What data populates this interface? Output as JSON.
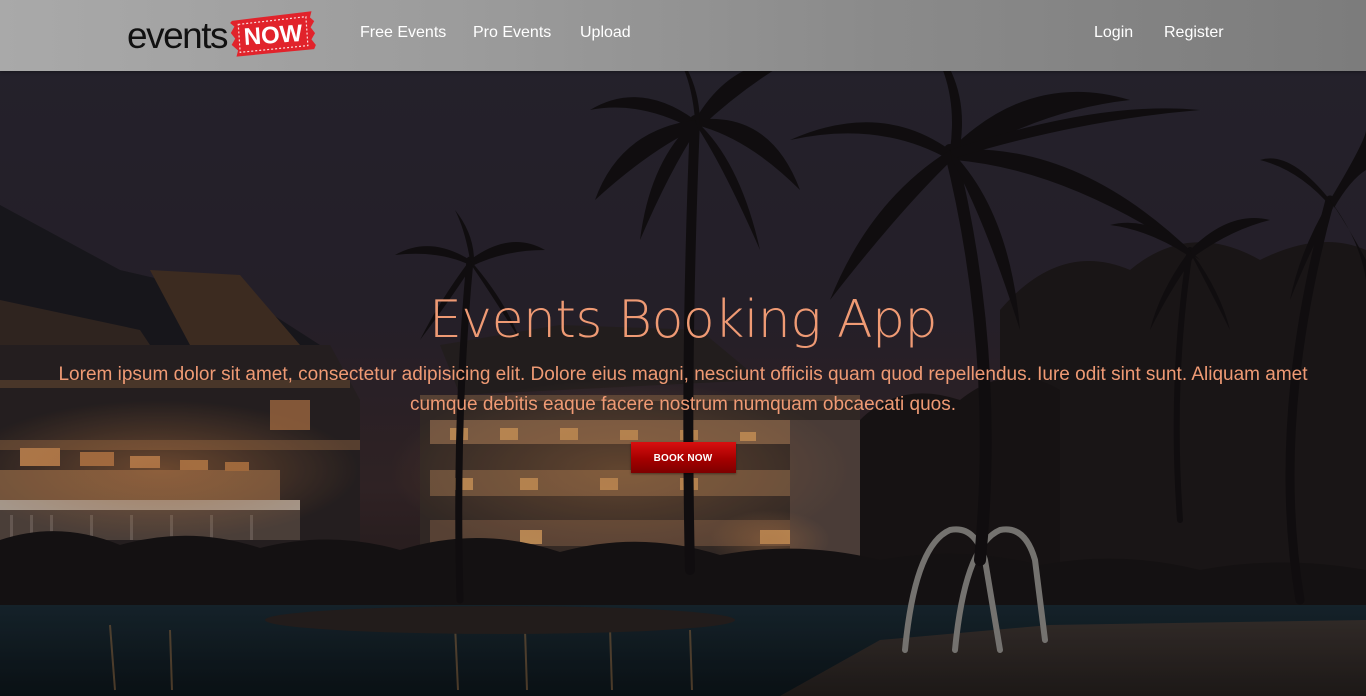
{
  "brand": {
    "logo_text_main": "events",
    "logo_text_badge": "NOW",
    "badge_color": "#e1232b"
  },
  "nav": {
    "left_links": [
      {
        "label": "Free Events"
      },
      {
        "label": "Pro Events"
      },
      {
        "label": "Upload"
      }
    ],
    "right_links": [
      {
        "label": "Login"
      },
      {
        "label": "Register"
      }
    ]
  },
  "hero": {
    "title": "Events Booking App",
    "description": "Lorem ipsum dolor sit amet, consectetur adipisicing elit. Dolore eius magni, nesciunt officiis quam quod repellendus. Iure odit sint sunt. Aliquam amet cumque debitis eaque facere nostrum numquam obcaecati quos.",
    "button_label": "BOOK NOW",
    "text_color": "#ef9a74",
    "button_color": "#b30000",
    "background_image": "night-resort-pool-palms"
  }
}
